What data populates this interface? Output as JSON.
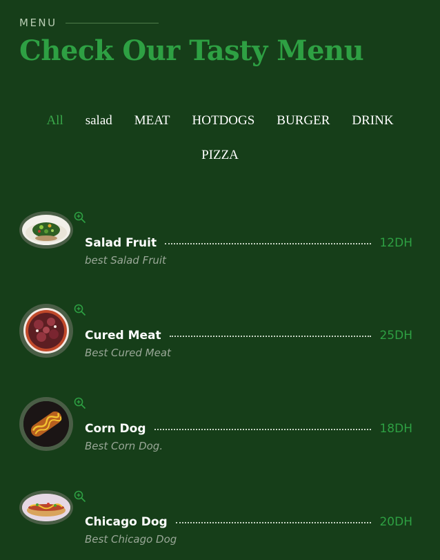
{
  "section_label": "MENU",
  "title": "Check Our Tasty Menu",
  "filters_row1": [
    "All",
    "salad",
    "MEAT",
    "HOTDOGS",
    "BURGER",
    "DRINK"
  ],
  "filters_row2": [
    "PIZZA"
  ],
  "active_filter": "All",
  "items": [
    {
      "name": "Salad Fruit",
      "desc": "best Salad Fruit",
      "price": "12DH"
    },
    {
      "name": "Cured Meat",
      "desc": "Best Cured Meat",
      "price": "25DH"
    },
    {
      "name": "Corn Dog",
      "desc": "Best Corn Dog.",
      "price": "18DH"
    },
    {
      "name": "Chicago Dog",
      "desc": "Best Chicago Dog",
      "price": "20DH"
    }
  ],
  "colors": {
    "background": "#163e19",
    "accent": "#2ea043"
  },
  "icons": {
    "zoom": "zoom-in-icon"
  }
}
